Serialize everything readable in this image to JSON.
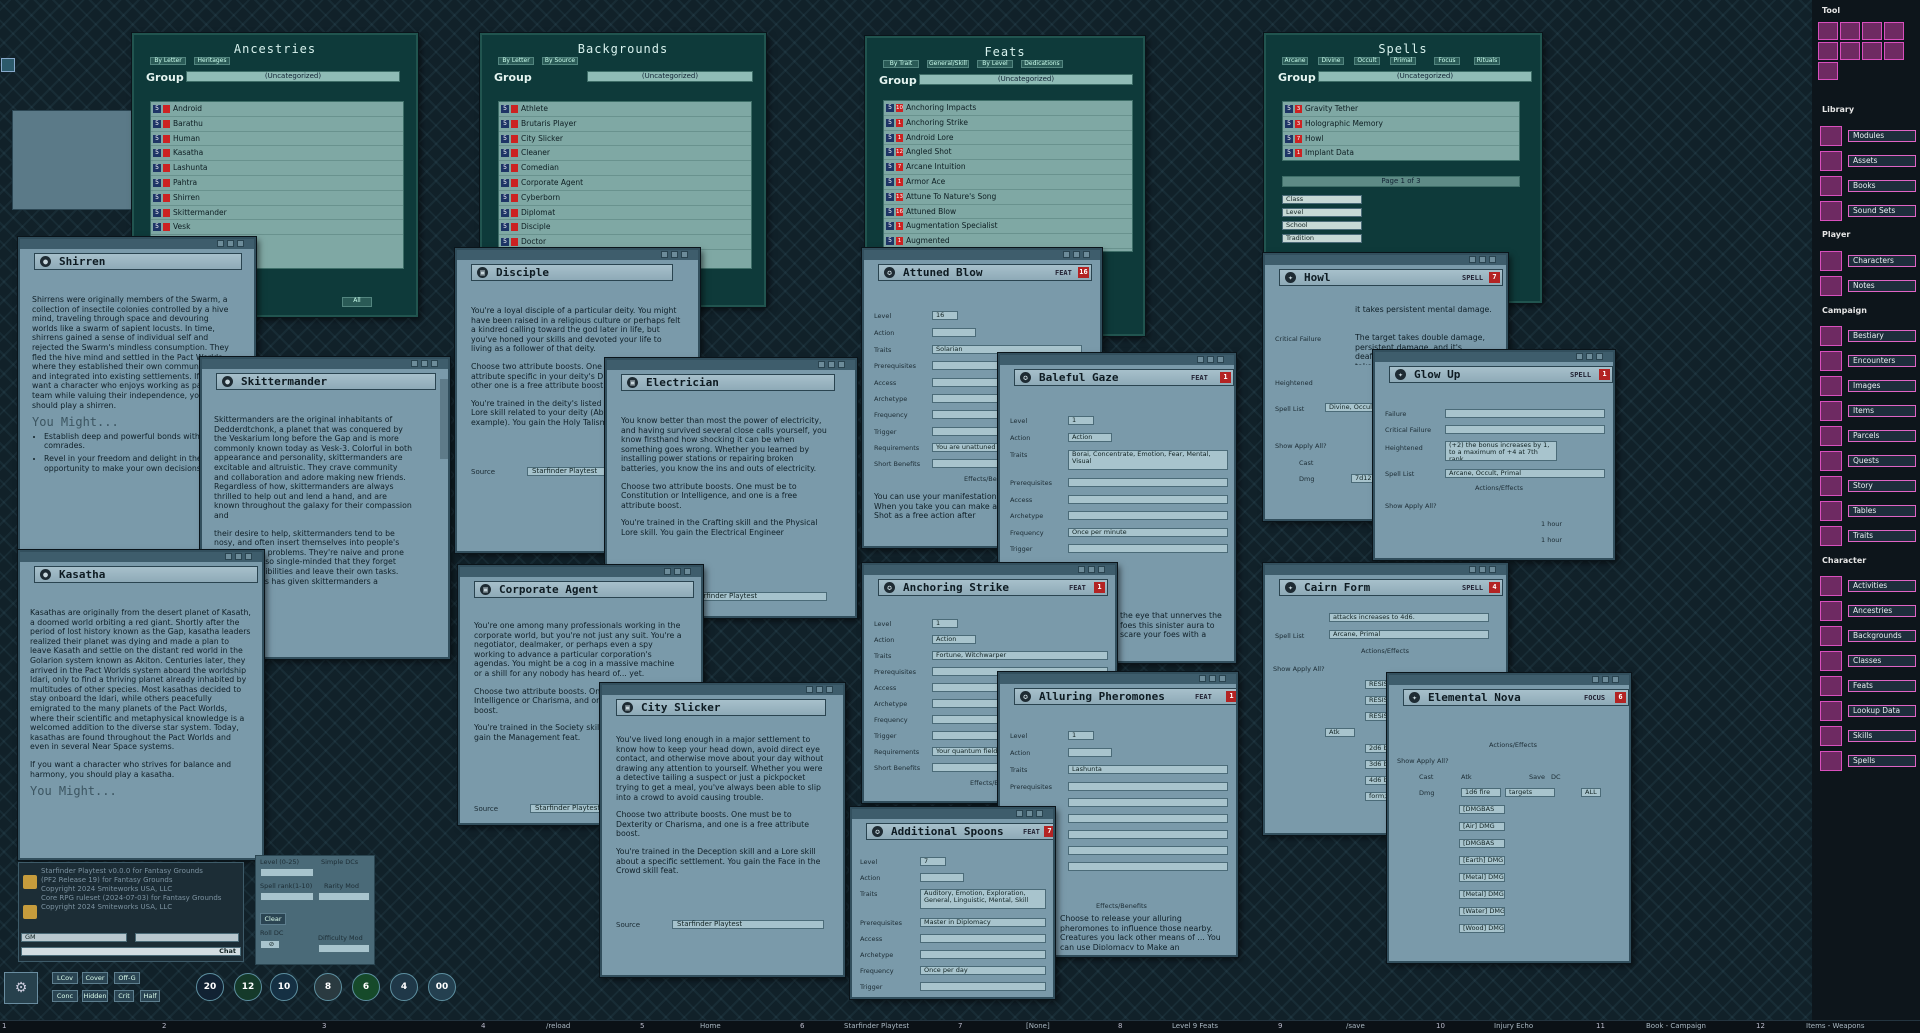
{
  "ancestries": {
    "title": "Ancestries",
    "filters": [
      "By Letter",
      "Heritages"
    ],
    "group_label": "Group",
    "group_value": "(Uncategorized)",
    "items": [
      "Android",
      "Barathu",
      "Human",
      "Kasatha",
      "Lashunta",
      "Pahtra",
      "Shirren",
      "Skittermander",
      "Vesk"
    ],
    "search_btn": "All"
  },
  "backgrounds": {
    "title": "Backgrounds",
    "filters": [
      "By Letter",
      "By Source"
    ],
    "group_label": "Group",
    "group_value": "(Uncategorized)",
    "items": [
      "Athlete",
      "Brutaris Player",
      "City Slicker",
      "Cleaner",
      "Comedian",
      "Corporate Agent",
      "Cyberborn",
      "Diplomat",
      "Disciple",
      "Doctor"
    ]
  },
  "feats": {
    "title": "Feats",
    "filters": [
      "By Trait",
      "General/Skill",
      "By Level",
      "Dedications"
    ],
    "group_label": "Group",
    "group_value": "(Uncategorized)",
    "items": [
      {
        "lvl": "10",
        "name": "Anchoring Impacts"
      },
      {
        "lvl": "1",
        "name": "Anchoring Strike"
      },
      {
        "lvl": "1",
        "name": "Android Lore"
      },
      {
        "lvl": "12",
        "name": "Angled Shot"
      },
      {
        "lvl": "7",
        "name": "Arcane Intuition"
      },
      {
        "lvl": "1",
        "name": "Armor Ace"
      },
      {
        "lvl": "13",
        "name": "Attune To Nature's Song"
      },
      {
        "lvl": "16",
        "name": "Attuned Blow"
      },
      {
        "lvl": "1",
        "name": "Augmentation Specialist"
      },
      {
        "lvl": "1",
        "name": "Augmented"
      }
    ]
  },
  "spells": {
    "title": "Spells",
    "filters": [
      "Arcane",
      "Divine",
      "Occult",
      "Primal",
      "Focus",
      "Rituals"
    ],
    "group_label": "Group",
    "group_value": "(Uncategorized)",
    "items": [
      {
        "lvl": "3",
        "name": "Gravity Tether"
      },
      {
        "lvl": "3",
        "name": "Holographic Memory"
      },
      {
        "lvl": "7",
        "name": "Howl"
      },
      {
        "lvl": "1",
        "name": "Implant Data"
      }
    ],
    "page": "Page 1 of 3",
    "filters2": [
      "Class",
      "Level",
      "School",
      "Tradition"
    ]
  },
  "shirren": {
    "title": "Shirren",
    "text": "Shirrens were originally members of the Swarm, a collection of insectile colonies controlled by a hive mind, traveling through space and devouring worlds like a swarm of sapient locusts. In time, shirrens gained a sense of individual self and rejected the Swarm's mindless consumption. They fled the hive mind and settled in the Pact Worlds, where they established their own communities and integrated into existing settlements. If you want a character who enjoys working as part of a team while valuing their independence, you should play a shirren.",
    "heading": "You Might...",
    "bullets": [
      "Establish deep and powerful bonds with comrades.",
      "Revel in your freedom and delight in the opportunity to make your own decisions."
    ]
  },
  "skittermander": {
    "title": "Skittermander",
    "text": "Skittermanders are the original inhabitants of Dedderdtchonk, a planet that was conquered by the Veskarium long before the Gap and is more commonly known today as Vesk-3. Colorful in both appearance and personality, skittermanders are excitable and altruistic. They crave community and collaboration and adore making new friends. Regardless of how, skittermanders are always thrilled to help out and lend a hand, and are known throughout the galaxy for their compassion and",
    "text2": "their desire to help, skittermanders tend to be nosy, and often insert themselves into people's business and problems. They're naive and prone to becoming so single-minded that they forget their responsibilities and leave their own tasks. Somehow this has given skittermanders a"
  },
  "kasatha": {
    "title": "Kasatha",
    "text": "Kasathas are originally from the desert planet of Kasath, a doomed world orbiting a red giant. Shortly after the period of lost history known as the Gap, kasatha leaders realized their planet was dying and made a plan to leave Kasath and settle on the distant red world in the Golarion system known as Akiton. Centuries later, they arrived in the Pact Worlds system aboard the worldship Idari, only to find a thriving planet already inhabited by multitudes of other species. Most kasathas decided to stay onboard the Idari, while others peacefully emigrated to the many planets of the Pact Worlds, where their scientific and metaphysical knowledge is a welcomed addition to the diverse star system. Today, kasathas are found throughout the Pact Worlds and even in several Near Space systems.",
    "text2": "If you want a character who strives for balance and harmony, you should play a kasatha.",
    "heading": "You Might..."
  },
  "disciple": {
    "title": "Disciple",
    "text": "You're a loyal disciple of a particular deity. You might have been raised in a religious culture or perhaps felt a kindred calling toward the god later in life, but you've honed your skills and devoted your life to living as a follower of that deity.",
    "text2": "Choose two attribute boosts. One must be to a attribute specific in your deity's Divine Font; the other one is a free attribute boost.",
    "text3": "You're trained in the deity's listed divine skill and a Lore skill related to your deity (Abadar Lore for example). You gain the Holy Talisman",
    "source_label": "Source",
    "source": "Starfinder Playtest"
  },
  "electrician": {
    "title": "Electrician",
    "text": "You know better than most the power of electricity, and having survived several close calls yourself, you know firsthand how shocking it can be when something goes wrong. Whether you learned by installing power stations or repairing broken batteries, you know the ins and outs of electricity.",
    "text2": "Choose two attribute boosts. One must be to Constitution or Intelligence, and one is a free attribute boost.",
    "text3": "You're trained in the Crafting skill and the Physical Lore skill. You gain the Electrical Engineer",
    "source": "Starfinder Playtest"
  },
  "corporate": {
    "title": "Corporate Agent",
    "text": "You're one among many professionals working in the corporate world, but you're not just any suit. You're a negotiator, dealmaker, or perhaps even a spy working to advance a particular corporation's agendas. You might be a cog in a massive machine or a shill for any nobody has heard of... yet.",
    "text2": "Choose two attribute boosts. One must be Intelligence or Charisma, and one is a free attribute boost.",
    "text3": "You're trained in the Society skill and a Lore skill. You gain the Management feat.",
    "source_label": "Source",
    "source": "Starfinder Playtest"
  },
  "cityslicker": {
    "title": "City Slicker",
    "text": "You've lived long enough in a major settlement to know how to keep your head down, avoid direct eye contact, and otherwise move about your day without drawing any attention to yourself. Whether you were a detective tailing a suspect or just a pickpocket trying to get a meal, you've always been able to slip into a crowd to avoid causing trouble.",
    "text2": "Choose two attribute boosts. One must be to Dexterity or Charisma, and one is a free attribute boost.",
    "text3": "You're trained in the Deception skill and a Lore skill about a specific settlement. You gain the Face in the Crowd skill feat.",
    "source_label": "Source",
    "source": "Starfinder Playtest"
  },
  "attuned": {
    "title": "Attuned Blow",
    "kind": "FEAT",
    "badge": "16",
    "labels": [
      "Level",
      "Action",
      "Traits",
      "Prerequisites",
      "Access",
      "Archetype",
      "Frequency",
      "Trigger",
      "Requirements",
      "Short Benefits"
    ],
    "level": "16",
    "traits": "Solarian",
    "requirements": "You are unattuned",
    "effects": "Effects/Benefits",
    "text": "You can use your manifestation by attuning yourself. When you take you can make a Strike with your Solar Shot as a free action after"
  },
  "baleful": {
    "title": "Baleful Gaze",
    "kind": "FEAT",
    "badge": "1",
    "labels": [
      "Level",
      "Action",
      "Traits",
      "Prerequisites",
      "Access",
      "Archetype",
      "Frequency",
      "Trigger"
    ],
    "level": "1",
    "action": "Action",
    "traits": "Borai, Concentrate, Emotion, Fear, Mental, Visual",
    "frequency": "Once per minute",
    "text": "the eye that unnerves the foes this sinister aura to scare your foes with a"
  },
  "anchoring": {
    "title": "Anchoring Strike",
    "kind": "FEAT",
    "badge": "1",
    "labels": [
      "Level",
      "Action",
      "Traits",
      "Prerequisites",
      "Access",
      "Archetype",
      "Frequency",
      "Trigger",
      "Requirements",
      "Short Benefits"
    ],
    "level": "1",
    "action": "Action",
    "traits": "Fortune, Witchwarper",
    "requirements": "Your quantum field",
    "effects": "Effects/Benefits"
  },
  "alluring": {
    "title": "Alluring Pheromones",
    "kind": "FEAT",
    "badge": "1",
    "labels": [
      "Level",
      "Action",
      "Traits",
      "Prerequisites"
    ],
    "level": "1",
    "traits": "Lashunta",
    "effects": "Effects/Benefits",
    "text": "Choose to release your alluring pheromones to influence those nearby. Creatures you lack other means of ... You can use Diplomacy to Make an"
  },
  "spoons": {
    "title": "Additional Spoons",
    "kind": "FEAT",
    "badge": "7",
    "labels": [
      "Level",
      "Action",
      "Traits",
      "Prerequisites",
      "Access",
      "Archetype",
      "Frequency",
      "Trigger"
    ],
    "level": "7",
    "traits": "Auditory, Emotion, Exploration, General, Linguistic, Mental, Skill",
    "prereq": "Master in Diplomacy",
    "frequency": "Once per day"
  },
  "howl": {
    "title": "Howl",
    "kind": "SPELL",
    "badge": "7",
    "crit_fail": "Critical Failure",
    "heightened": "Heightened",
    "spell_list": "Spell List",
    "spell_list_val": "Divine, Occult",
    "text1": "it takes persistent mental damage.",
    "text2": "The target takes double damage, persistent damage, and it's deafened. If it was deafened it takes persistent",
    "show_apply": "Show Apply All?",
    "cast": "Cast",
    "dmg": "Dmg",
    "dmg_val": "7d12"
  },
  "glowup": {
    "title": "Glow Up",
    "kind": "SPELL",
    "badge": "1",
    "labels": [
      "Success",
      "Failure",
      "Critical Failure"
    ],
    "heightened": "Heightened",
    "heightened_text": "(+2) the bonus increases by 1, to a maximum of +4 at 7th rank.",
    "spell_list": "Spell List",
    "spell_list_val": "Arcane, Occult, Primal",
    "effects": "Actions/Effects",
    "show_apply": "Show Apply All?",
    "durations": [
      "1 hour",
      "1 hour",
      "1 hour",
      "1 hour"
    ]
  },
  "cairn": {
    "title": "Cairn Form",
    "kind": "SPELL",
    "badge": "4",
    "text": "attacks increases to 4d6.",
    "spell_list": "Spell List",
    "spell_list_val": "Arcane, Primal",
    "effects": "Actions/Effects",
    "show_apply": "Show Apply All?",
    "rows": [
      "RESIST: 5 ph",
      "RESIST: 10 ph",
      "RESIST: 15 ph",
      "Atk",
      "2d6 bludgeon",
      "3d6 bludgeon",
      "4d6 bludgeon",
      "form; Stun"
    ]
  },
  "nova": {
    "title": "Elemental Nova",
    "kind": "FOCUS",
    "badge": "6",
    "effects": "Actions/Effects",
    "show_apply": "Show Apply All?",
    "cast": "Cast",
    "atk": "Atk",
    "save": "Save",
    "dc": "DC",
    "dmg": "Dmg",
    "dmg_val": "1d6 fire",
    "targets": "targets",
    "all": "ALL",
    "rows": [
      "[DMGBAS",
      "[Air] DMG",
      "[DMGBAS",
      "[Earth] DMG",
      "[Metal] DMG",
      "[Metal] DMG",
      "[Water] DMG",
      "[Wood] DMG"
    ]
  },
  "chat": {
    "lines": [
      "Starfinder Playtest v0.0.0 for Fantasy Grounds",
      "(PF2 Release 19) for Fantasy Grounds",
      "Copyright 2024 Smiteworks USA, LLC",
      "Core RPG ruleset (2024-07-03) for Fantasy Grounds",
      "Copyright 2024 Smiteworks USA, LLC"
    ],
    "mode": "GM",
    "chat_btn": "Chat"
  },
  "dice_panel": {
    "labels": [
      "Level (0-25)",
      "Simple DCs",
      "Spell rank(1-10)",
      "Rarity Mod",
      "Roll DC",
      "Difficulty Mod"
    ],
    "clear": "Clear"
  },
  "hotkeys": {
    "row1": [
      "LCov",
      "Cover",
      "Off-G"
    ],
    "row2": [
      "Conc",
      "Hidden",
      "Crit",
      "Half"
    ],
    "dice": [
      "20",
      "12",
      "10",
      "8",
      "6",
      "4",
      "00"
    ]
  },
  "sidebar": {
    "tool": "Tool",
    "library": "Library",
    "library_items": [
      "Modules",
      "Assets",
      "Books",
      "Sound Sets"
    ],
    "player": "Player",
    "player_items": [
      "Characters",
      "Notes"
    ],
    "campaign": "Campaign",
    "campaign_items": [
      "Bestiary",
      "Encounters",
      "Images",
      "Items",
      "Parcels",
      "Quests",
      "Story",
      "Tables",
      "Traits"
    ],
    "character": "Character",
    "character_items": [
      "Activities",
      "Ancestries",
      "Backgrounds",
      "Classes",
      "Feats",
      "Lookup Data",
      "Skills",
      "Spells"
    ]
  },
  "hotbar": {
    "numbers": [
      "1",
      "2",
      "3",
      "4",
      "5",
      "6",
      "7",
      "8",
      "9",
      "10",
      "11",
      "12"
    ],
    "labels": [
      "/reload",
      "Home",
      "Starfinder Playtest",
      "[None]",
      "Level 9 Feats",
      "/save",
      "Injury Echo",
      "Book - Campaign",
      "Items - Weapons"
    ]
  }
}
